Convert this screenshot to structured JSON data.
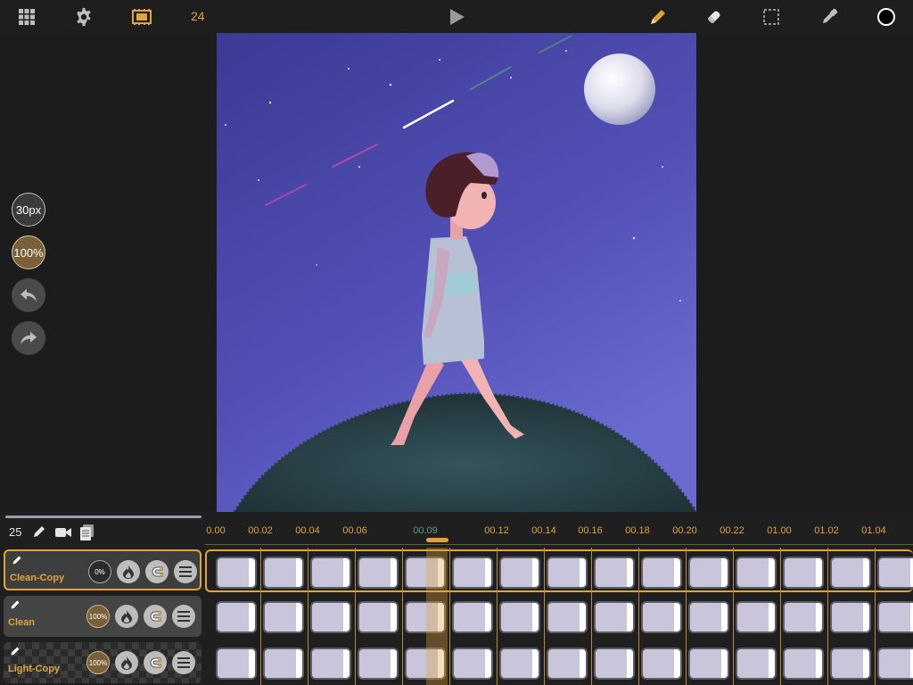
{
  "toolbar": {
    "fps": "24",
    "icons": [
      "grid-icon",
      "gear-icon",
      "film-icon",
      "play-icon",
      "pencil-icon",
      "eraser-icon",
      "selection-icon",
      "eyedropper-icon",
      "color-swatch-icon"
    ]
  },
  "left_tools": {
    "brush_size": "30px",
    "opacity": "100%"
  },
  "timeline": {
    "frame_count": "25",
    "ruler_labels": [
      {
        "text": "0.00",
        "current": false
      },
      {
        "text": "00.02",
        "current": false
      },
      {
        "text": "00.04",
        "current": false
      },
      {
        "text": "00.06",
        "current": false
      },
      {
        "text": "00.09",
        "current": true
      },
      {
        "text": "00.12",
        "current": false
      },
      {
        "text": "00.14",
        "current": false
      },
      {
        "text": "00.16",
        "current": false
      },
      {
        "text": "00.18",
        "current": false
      },
      {
        "text": "00.20",
        "current": false
      },
      {
        "text": "00.22",
        "current": false
      },
      {
        "text": "01.00",
        "current": false
      },
      {
        "text": "01.02",
        "current": false
      },
      {
        "text": "01.04",
        "current": false
      }
    ],
    "layers": [
      {
        "name": "Clean-Copy",
        "opacity": "0%",
        "active": true
      },
      {
        "name": "Clean",
        "opacity": "100%",
        "active": false
      },
      {
        "name": "Light-Copy",
        "opacity": "100%",
        "active": false
      }
    ]
  },
  "colors": {
    "accent": "#e0a43a",
    "background": "#1c1c1c",
    "sky_top": "#3c3a94",
    "sky_bottom": "#6a6ad0"
  }
}
